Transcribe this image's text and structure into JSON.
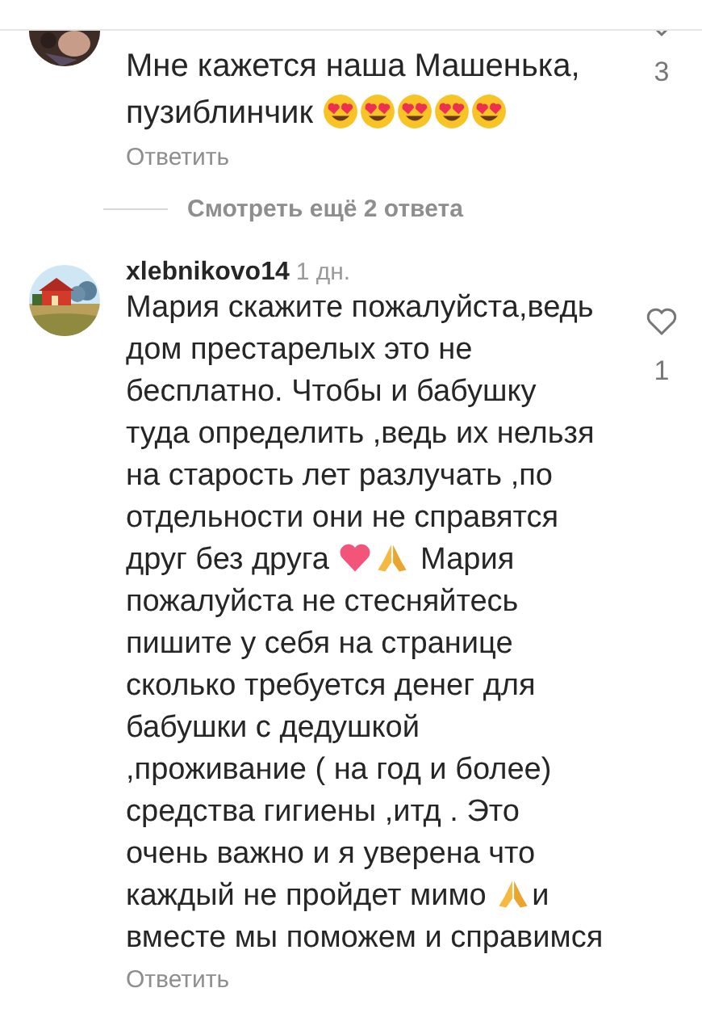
{
  "comments": [
    {
      "body": [
        {
          "kind": "text",
          "text": "Мне кажется наша Машенька, пузиблинчик "
        },
        {
          "kind": "heart-eyes"
        },
        {
          "kind": "heart-eyes"
        },
        {
          "kind": "heart-eyes"
        },
        {
          "kind": "heart-eyes"
        },
        {
          "kind": "heart-eyes"
        }
      ],
      "reply": "Ответить",
      "likes": "3"
    },
    {
      "username": "xlebnikovo14",
      "time": "1 дн.",
      "body": [
        {
          "kind": "text",
          "text": "Мария скажите пожалуйста,ведь дом престарелых это не бесплатно. Чтобы и бабушку туда определить ,ведь их нельзя на старость лет разлучать ,по отдельности они не справятся друг без друга "
        },
        {
          "kind": "heart"
        },
        {
          "kind": "pray"
        },
        {
          "kind": "text",
          "text": " Мария пожалуйста не стесняйтесь пишите у себя на странице сколько требуется денег для бабушки с дедушкой ,проживание ( на год и более) средства гигиены ,итд . Это очень важно и я уверена что каждый не пройдет мимо "
        },
        {
          "kind": "pray"
        },
        {
          "kind": "text",
          "text": "и вместе мы поможем и справимся"
        }
      ],
      "reply": "Ответить",
      "likes": "1"
    }
  ],
  "more_replies": "Смотреть ещё 2 ответа"
}
